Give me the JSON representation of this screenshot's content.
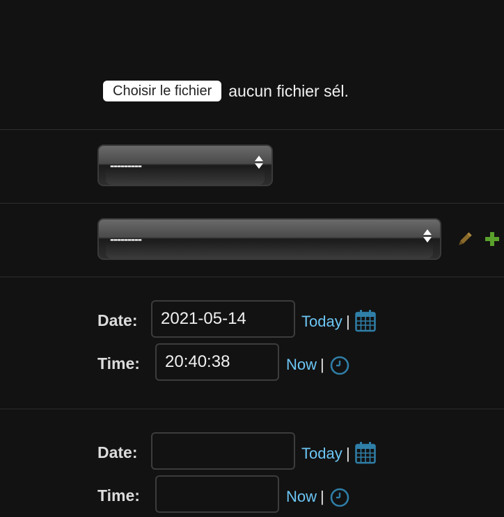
{
  "file_input": {
    "button_label": "Choisir le fichier",
    "status_text": "aucun fichier sél."
  },
  "select_1": {
    "selected_value": "---------"
  },
  "select_2": {
    "selected_value": "---------",
    "edit_icon": "pencil-icon",
    "add_icon": "plus-icon"
  },
  "datetime_1": {
    "date_label": "Date:",
    "date_value": "2021-05-14",
    "today_label": "Today",
    "separator": "|",
    "calendar_icon": "calendar-icon",
    "time_label": "Time:",
    "time_value": "20:40:38",
    "now_label": "Now",
    "clock_icon": "clock-icon"
  },
  "datetime_2": {
    "date_label": "Date:",
    "date_value": "",
    "today_label": "Today",
    "separator": "|",
    "calendar_icon": "calendar-icon",
    "time_label": "Time:",
    "time_value": "",
    "now_label": "Now",
    "clock_icon": "clock-icon"
  },
  "colors": {
    "background": "#121212",
    "link": "#6cc6f5",
    "icon_blue": "#2f7fa8",
    "pencil": "#8a6a2a",
    "plus": "#5aa02c"
  }
}
